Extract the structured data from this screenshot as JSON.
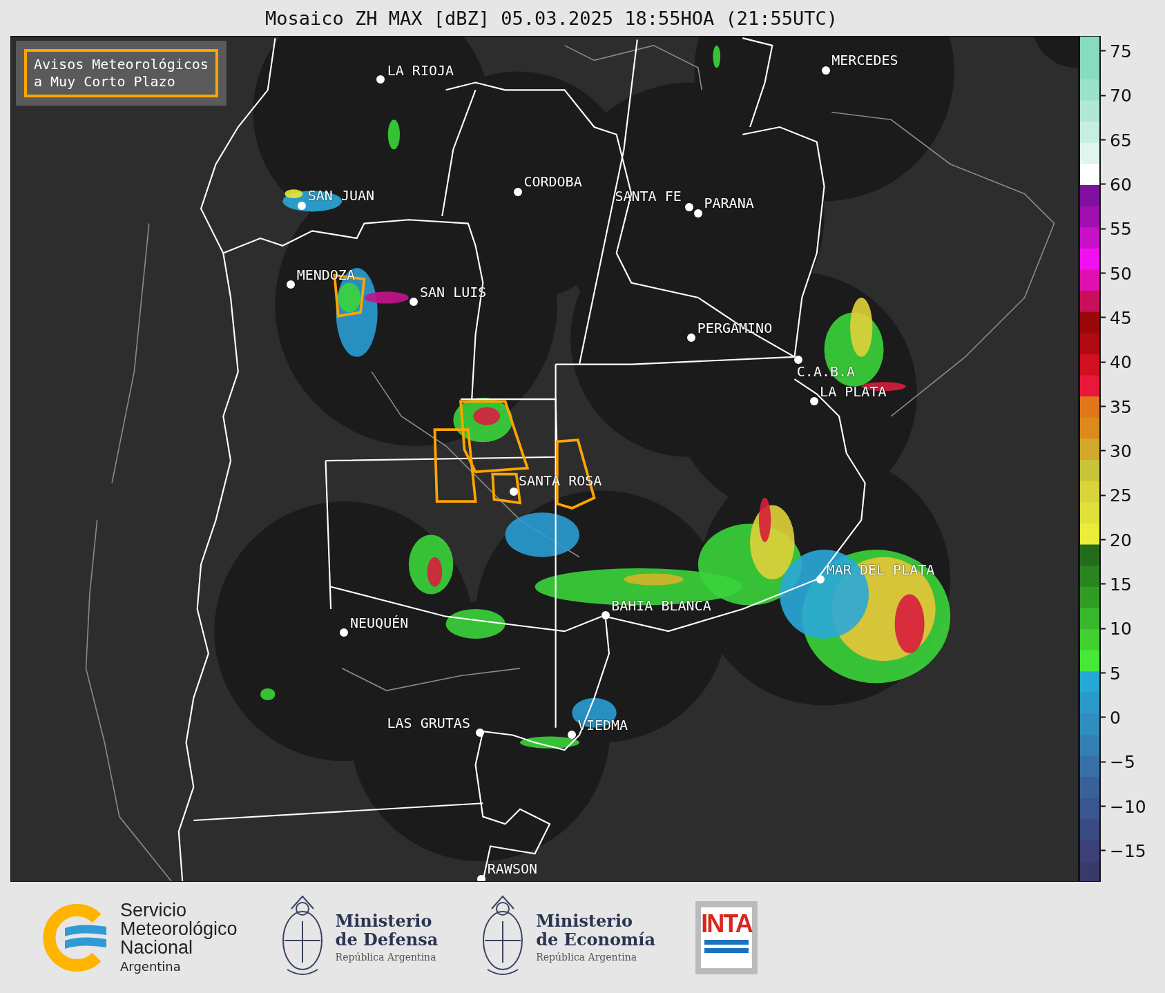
{
  "title": "Mosaico ZH MAX [dBZ] 05.03.2025 18:55HOA (21:55UTC)",
  "legend": {
    "label": "Avisos Meteorológicos\na Muy Corto Plazo"
  },
  "cities": [
    {
      "name": "LA RIOJA"
    },
    {
      "name": "MERCEDES"
    },
    {
      "name": "CORDOBA"
    },
    {
      "name": "SAN JUAN"
    },
    {
      "name": "SANTA FE"
    },
    {
      "name": "PARANA"
    },
    {
      "name": "MENDOZA"
    },
    {
      "name": "SAN LUIS"
    },
    {
      "name": "PERGAMINO"
    },
    {
      "name": "C.A.B.A"
    },
    {
      "name": "LA PLATA"
    },
    {
      "name": "SANTA ROSA"
    },
    {
      "name": "MAR DEL PLATA"
    },
    {
      "name": "BAHIA BLANCA"
    },
    {
      "name": "NEUQUÉN"
    },
    {
      "name": "LAS GRUTAS"
    },
    {
      "name": "VIEDMA"
    },
    {
      "name": "RAWSON"
    }
  ],
  "colorbar": {
    "ticks": [
      "75",
      "70",
      "65",
      "60",
      "55",
      "50",
      "45",
      "40",
      "35",
      "30",
      "25",
      "20",
      "15",
      "10",
      "5",
      "0",
      "−5",
      "−10",
      "−15"
    ]
  },
  "footer": {
    "logos": [
      {
        "kind": "smn",
        "lines": [
          "Servicio",
          "Meteorológico",
          "Nacional"
        ],
        "sub": "Argentina"
      },
      {
        "kind": "ministry",
        "lines": [
          "Ministerio",
          "de Defensa"
        ],
        "sub": "República Argentina"
      },
      {
        "kind": "ministry",
        "lines": [
          "Ministerio",
          "de Economía"
        ],
        "sub": "República Argentina"
      },
      {
        "kind": "inta",
        "lines": [
          "INTA"
        ]
      }
    ]
  }
}
